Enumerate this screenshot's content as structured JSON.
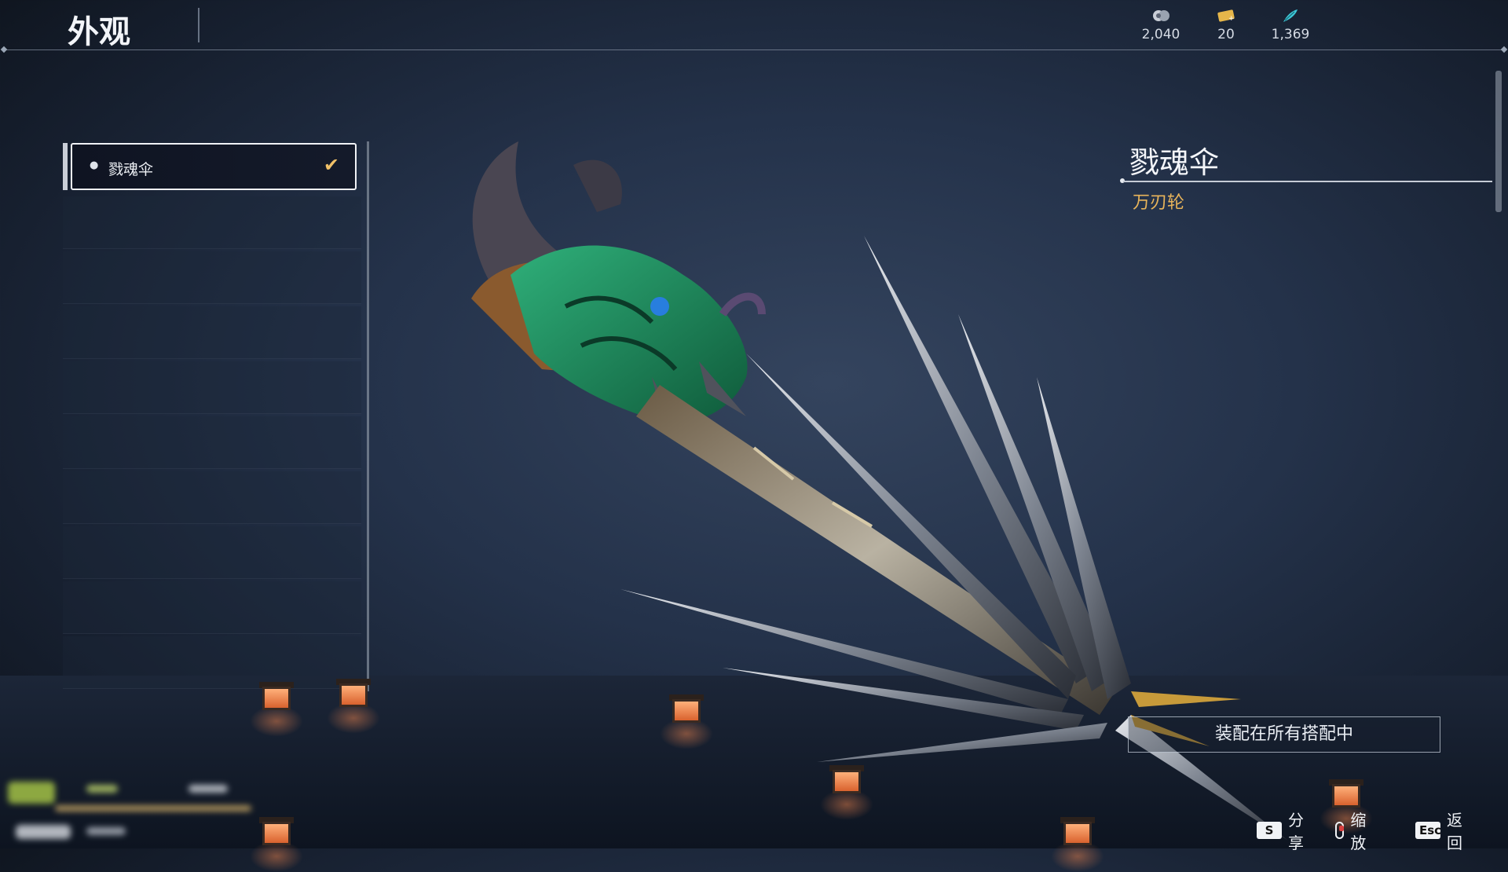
{
  "header": {
    "title": "外观",
    "currencies": [
      {
        "icon": "coin-icon",
        "value": "2,040",
        "color": "#c9ced7"
      },
      {
        "icon": "ticket-icon",
        "value": "20",
        "color": "#e6b64a"
      },
      {
        "icon": "feather-icon",
        "value": "1,369",
        "color": "#3ec8d8"
      }
    ]
  },
  "list": {
    "items": [
      {
        "label": "戮魂伞",
        "selected": true,
        "equipped": true
      }
    ]
  },
  "detail": {
    "name": "戮魂伞",
    "type": "万刃轮",
    "equip_all_label": "装配在所有搭配中"
  },
  "hints": [
    {
      "key": "S",
      "label": "分享"
    },
    {
      "key": "mouse-right",
      "label": "缩放"
    },
    {
      "key": "Esc",
      "label": "返回"
    }
  ],
  "colors": {
    "accent_gold": "#e8b45a",
    "check": "#f0c068",
    "weapon_jade": "#1f8a5a"
  }
}
